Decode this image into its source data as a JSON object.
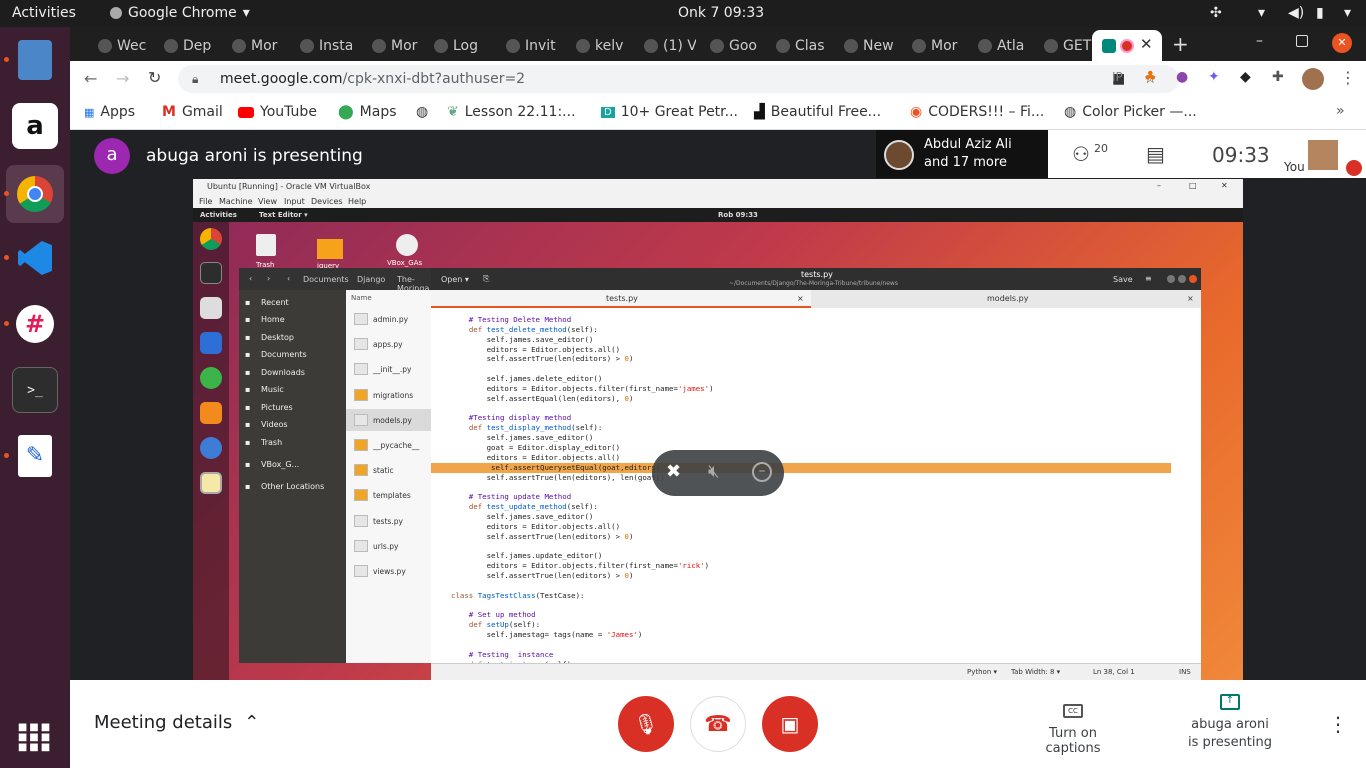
{
  "topbar": {
    "activities": "Activities",
    "app": "Google Chrome",
    "clock": "Onk 7  09:33"
  },
  "tabs": [
    "Wec",
    "Dep",
    "Mor",
    "Insta",
    "Mor",
    "Log",
    "Invit",
    "kelv",
    "(1) V",
    "Goo",
    "Clas",
    "New",
    "Mor",
    "Atla",
    "GET"
  ],
  "address": {
    "host": "meet.google.com",
    "path": "/cpk-xnxi-dbt?authuser=2"
  },
  "bookmarks": [
    "Apps",
    "Gmail",
    "YouTube",
    "Maps",
    "Lesson 22.11:...",
    "10+ Great Petr...",
    "Beautiful Free...",
    "CODERS!!! – Fi...",
    "Color Picker —..."
  ],
  "meet": {
    "presenter_initial": "a",
    "presenter_text": "abuga aroni is presenting",
    "participants_name": "Abdul Aziz Ali",
    "participants_more": "and 17 more",
    "participant_count": "20",
    "time": "09:33",
    "you_label": "You",
    "meeting_details": "Meeting details",
    "captions": "Turn on captions",
    "presenting_line1": "abuga aroni",
    "presenting_line2": "is presenting"
  },
  "vm": {
    "title": "Ubuntu [Running] - Oracle VM VirtualBox",
    "menu": [
      "File",
      "Machine",
      "View",
      "Input",
      "Devices",
      "Help"
    ],
    "activities": "Activities",
    "text_editor": "Text Editor ▾",
    "clock": "Rob 09:33",
    "desktop_icons": [
      "Trash",
      "jquery",
      "VBox_GAs"
    ],
    "fm_path": [
      "Documents",
      "Django",
      "The-Moringa"
    ],
    "fm_places": [
      "Recent",
      "Home",
      "Desktop",
      "Documents",
      "Downloads",
      "Music",
      "Pictures",
      "Videos",
      "Trash",
      "VBox_G...",
      "Other Locations"
    ],
    "fm_header": "Name",
    "fm_files": [
      "admin.py",
      "apps.py",
      "__init__.py",
      "migrations",
      "models.py",
      "__pycache__",
      "static",
      "templates",
      "tests.py",
      "urls.py",
      "views.py"
    ],
    "editor_open": "Open ▾",
    "editor_title": "tests.py",
    "editor_path": "~/Documents/Django/The-Moringa-Tribune/tribune/news",
    "editor_save": "Save",
    "editor_tabs": [
      "tests.py",
      "models.py"
    ],
    "status": [
      "Python ▾",
      "Tab Width: 8 ▾",
      "Ln 38, Col 1",
      "INS"
    ]
  }
}
